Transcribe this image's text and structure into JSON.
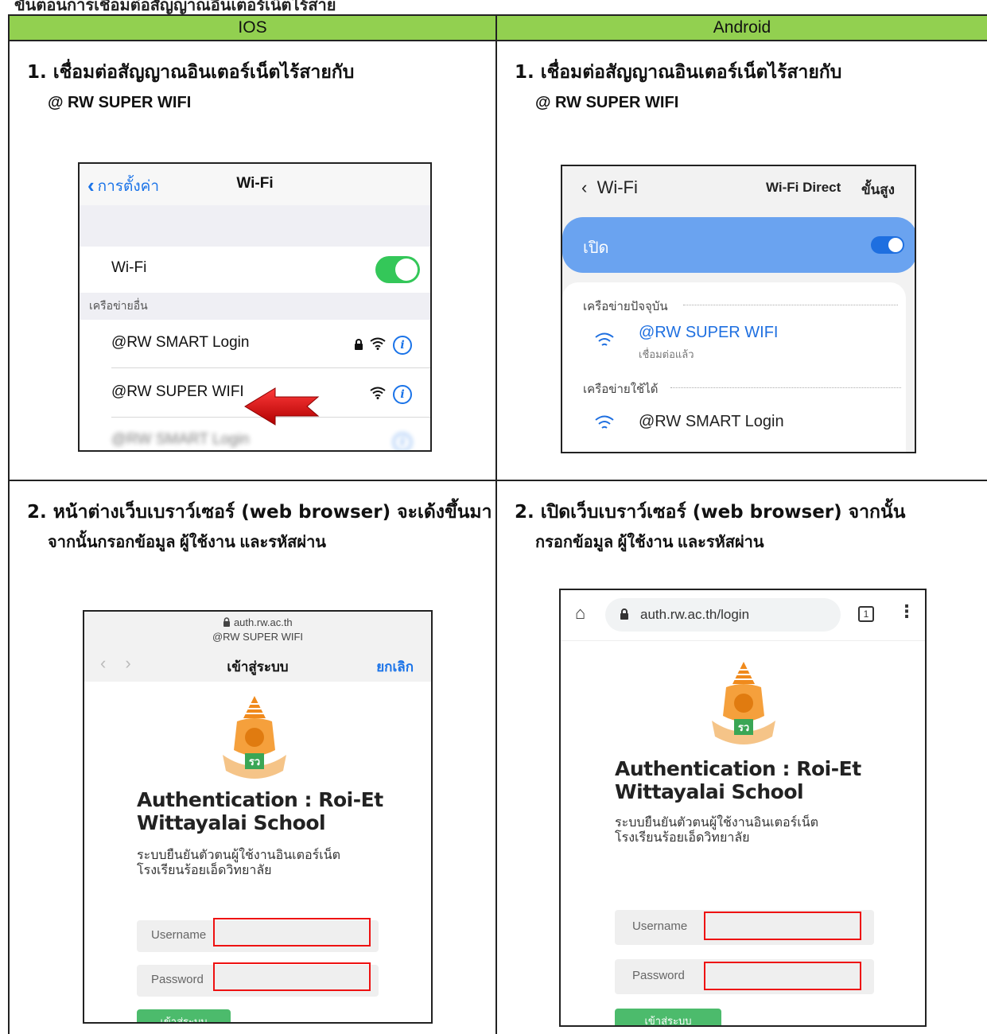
{
  "top_text": "ขั้นตอนการเชื่อมต่อสัญญาณอินเตอร์เน็ตไร้สาย",
  "columns": {
    "ios": "IOS",
    "android": "Android"
  },
  "steps": {
    "ios_1": {
      "title": "1. เชื่อมต่อสัญญาณอินเตอร์เน็ตไร้สายกับ",
      "sub": "@ RW SUPER WIFI"
    },
    "android_1": {
      "title": "1. เชื่อมต่อสัญญาณอินเตอร์เน็ตไร้สายกับ",
      "sub": "@ RW SUPER WIFI"
    },
    "ios_2": {
      "title": "2. หน้าต่างเว็บเบราว์เซอร์ (web browser) จะเด้งขึ้นมา",
      "sub": "จากนั้นกรอกข้อมูล ผู้ใช้งาน และรหัสผ่าน"
    },
    "android_2": {
      "title": "2. เปิดเว็บเบราว์เซอร์ (web browser) จากนั้น",
      "sub": "กรอกข้อมูล ผู้ใช้งาน และรหัสผ่าน"
    }
  },
  "ios_wifi": {
    "back_label": "การตั้งค่า",
    "nav_title": "Wi-Fi",
    "wifi_label": "Wi-Fi",
    "wifi_on": true,
    "other_networks": "เครือข่ายอื่น",
    "networks": [
      "@RW SMART Login",
      "@RW SUPER WIFI",
      "@RW SMART Login"
    ],
    "info_glyph": "i"
  },
  "android_wifi": {
    "back_label": "Wi-Fi",
    "direct_label": "Wi-Fi Direct",
    "advanced_label": "ขั้นสูง",
    "on_label": "เปิด",
    "current_section": "เครือข่ายปัจจุบัน",
    "connected_ssid": "@RW SUPER WIFI",
    "connected_status": "เชื่อมต่อแล้ว",
    "available_section": "เครือข่ายใช้ได้",
    "available_ssid": "@RW SMART Login"
  },
  "login_ios": {
    "url": "auth.rw.ac.th",
    "ssid": "@RW SUPER WIFI",
    "nav_title": "เข้าสู่ระบบ",
    "cancel": "ยกเลิก",
    "auth_title_1": "Authentication : Roi-Et",
    "auth_title_2": "Wittayalai School",
    "sub_1": "ระบบยืนยันตัวตนผู้ใช้งานอินเตอร์เน็ต",
    "sub_2": "โรงเรียนร้อยเอ็ดวิทยาลัย",
    "username": "Username",
    "password": "Password",
    "button": "เข้าสู่ระบบ"
  },
  "login_android": {
    "url": "auth.rw.ac.th/login",
    "tabs": "1",
    "auth_title_1": "Authentication : Roi-Et",
    "auth_title_2": "Wittayalai School",
    "sub_1": "ระบบยืนยันตัวตนผู้ใช้งานอินเตอร์เน็ต",
    "sub_2": "โรงเรียนร้อยเอ็ดวิทยาลัย",
    "username": "Username",
    "password": "Password",
    "button": "เข้าสู่ระบบ"
  },
  "colors": {
    "header_green": "#92d050",
    "ios_blue": "#1a73e8",
    "ios_toggle": "#34c759",
    "android_blue": "#1e6fe0",
    "highlight_red": "#e11111",
    "login_green": "#4cbb6c"
  }
}
